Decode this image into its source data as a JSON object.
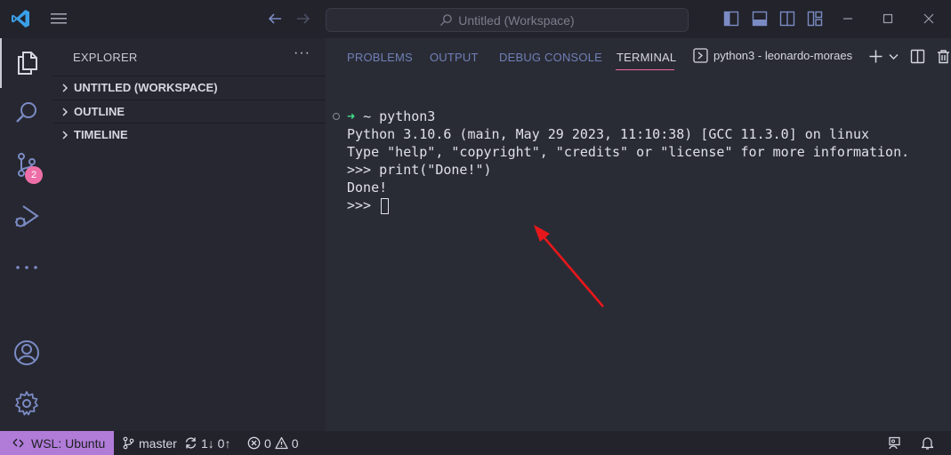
{
  "titlebar": {
    "search_text": "Untitled (Workspace)"
  },
  "activitybar": {
    "scm_badge": "2"
  },
  "sidebar": {
    "title": "EXPLORER",
    "more": "···",
    "sections": [
      {
        "label": "UNTITLED (WORKSPACE)"
      },
      {
        "label": "OUTLINE"
      },
      {
        "label": "TIMELINE"
      }
    ]
  },
  "panel": {
    "tabs": [
      {
        "label": "PROBLEMS"
      },
      {
        "label": "OUTPUT"
      },
      {
        "label": "DEBUG CONSOLE"
      },
      {
        "label": "TERMINAL"
      }
    ],
    "terminal_name": "python3 - leonardo-moraes"
  },
  "terminal": {
    "prompt_arrow": "➜",
    "prompt_dir": "~",
    "command": "python3",
    "lines": [
      "Python 3.10.6 (main, May 29 2023, 11:10:38) [GCC 11.3.0] on linux",
      "Type \"help\", \"copyright\", \"credits\" or \"license\" for more information.",
      ">>> print(\"Done!\")",
      "Done!",
      ">>> "
    ]
  },
  "statusbar": {
    "remote": "WSL: Ubuntu",
    "branch": "master",
    "sync": "1↓ 0↑",
    "errors": "0",
    "warnings": "0"
  },
  "colors": {
    "accent_pink": "#f06aa8",
    "remote_purple": "#b07cd8",
    "prompt_green": "#3fe08a",
    "annotation_red": "#e8171b"
  }
}
